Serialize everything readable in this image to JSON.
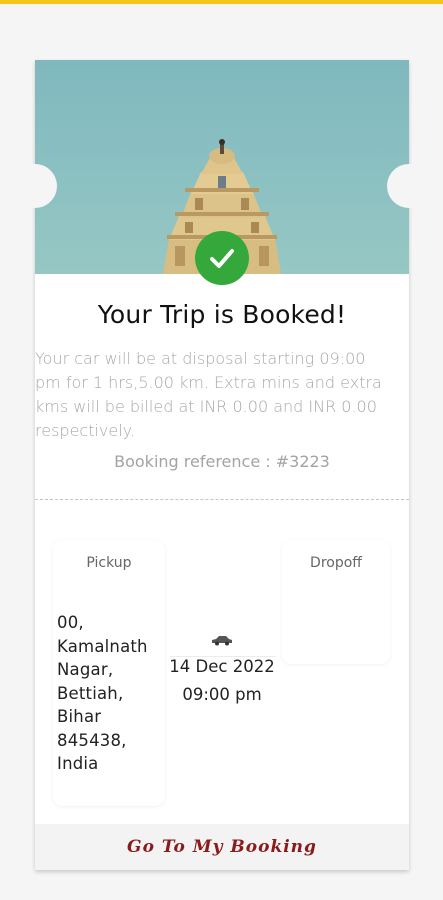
{
  "trip": {
    "title": "Your Trip is Booked!",
    "description": "Your car will be at disposal starting 09:00 pm for 1 hrs,5.00 km. Extra mins and extra kms will be billed at  INR 0.00 and INR 0.00 respectively.",
    "booking_reference": "Booking reference : #3223"
  },
  "pickup": {
    "label": "Pickup",
    "address": "00, Kamalnath Nagar, Bettiah, Bihar 845438, India"
  },
  "dropoff": {
    "label": "Dropoff",
    "address": ""
  },
  "schedule": {
    "date": "14 Dec 2022",
    "time": "09:00 pm"
  },
  "footer": {
    "button_label": "Go To My Booking"
  },
  "colors": {
    "accent_top": "#f5c51b",
    "success": "#34a83a",
    "button_text": "#8b1a1a"
  },
  "icons": {
    "status": "check-icon",
    "vehicle": "car-icon"
  }
}
